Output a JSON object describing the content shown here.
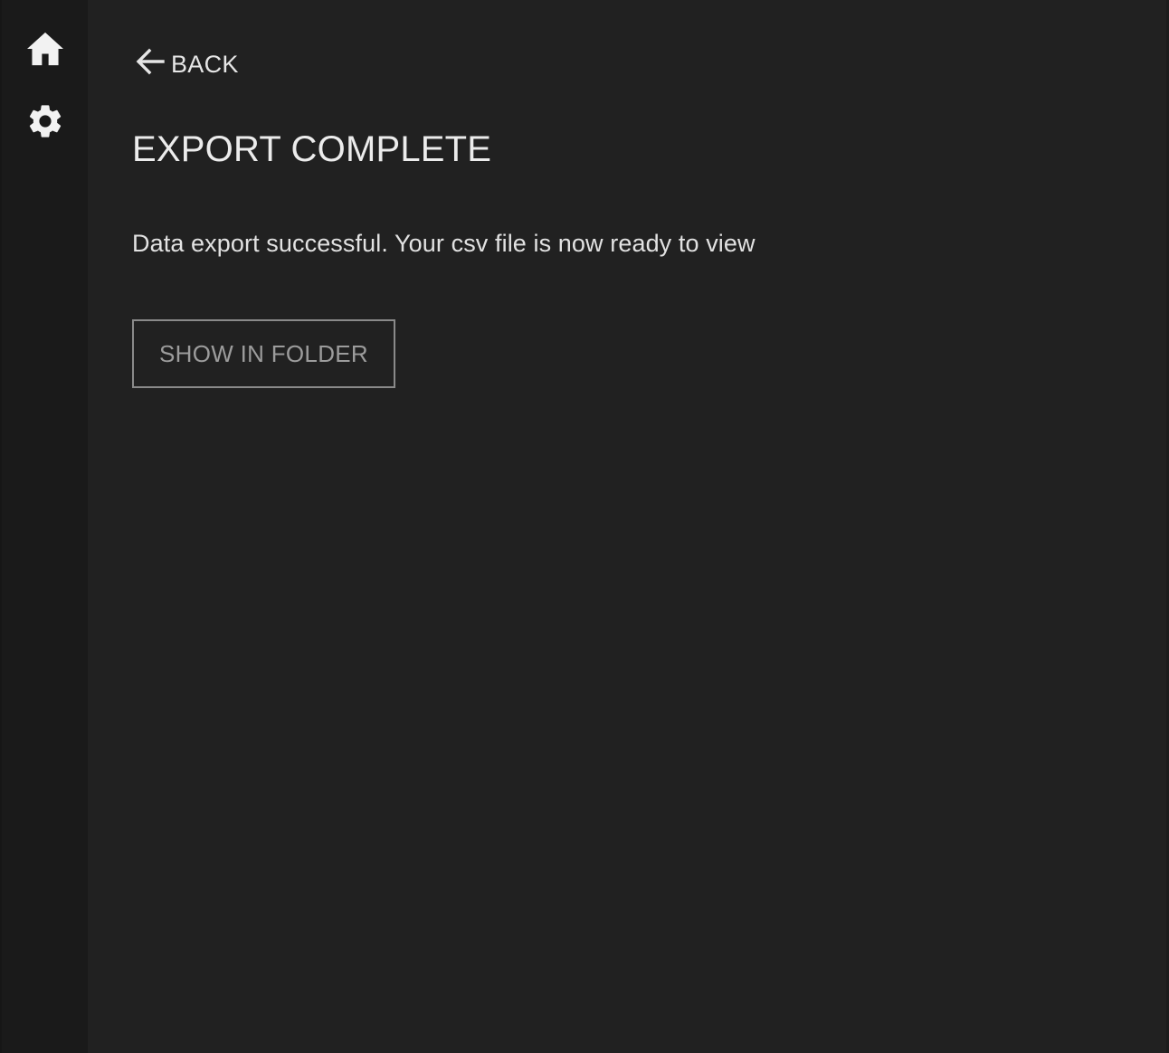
{
  "sidebar": {
    "items": [
      {
        "name": "home",
        "icon": "home-icon"
      },
      {
        "name": "settings",
        "icon": "gear-icon"
      }
    ]
  },
  "header": {
    "back_label": "BACK",
    "back_icon": "arrow-left-icon"
  },
  "main": {
    "title": "EXPORT COMPLETE",
    "message": "Data export successful. Your csv file is now ready to view",
    "show_in_folder_label": "SHOW IN FOLDER"
  },
  "colors": {
    "background": "#212121",
    "sidebar": "#1a1a1a",
    "text": "#ececec",
    "button_border": "#8a8a8a",
    "button_text": "#9c9c9c"
  }
}
